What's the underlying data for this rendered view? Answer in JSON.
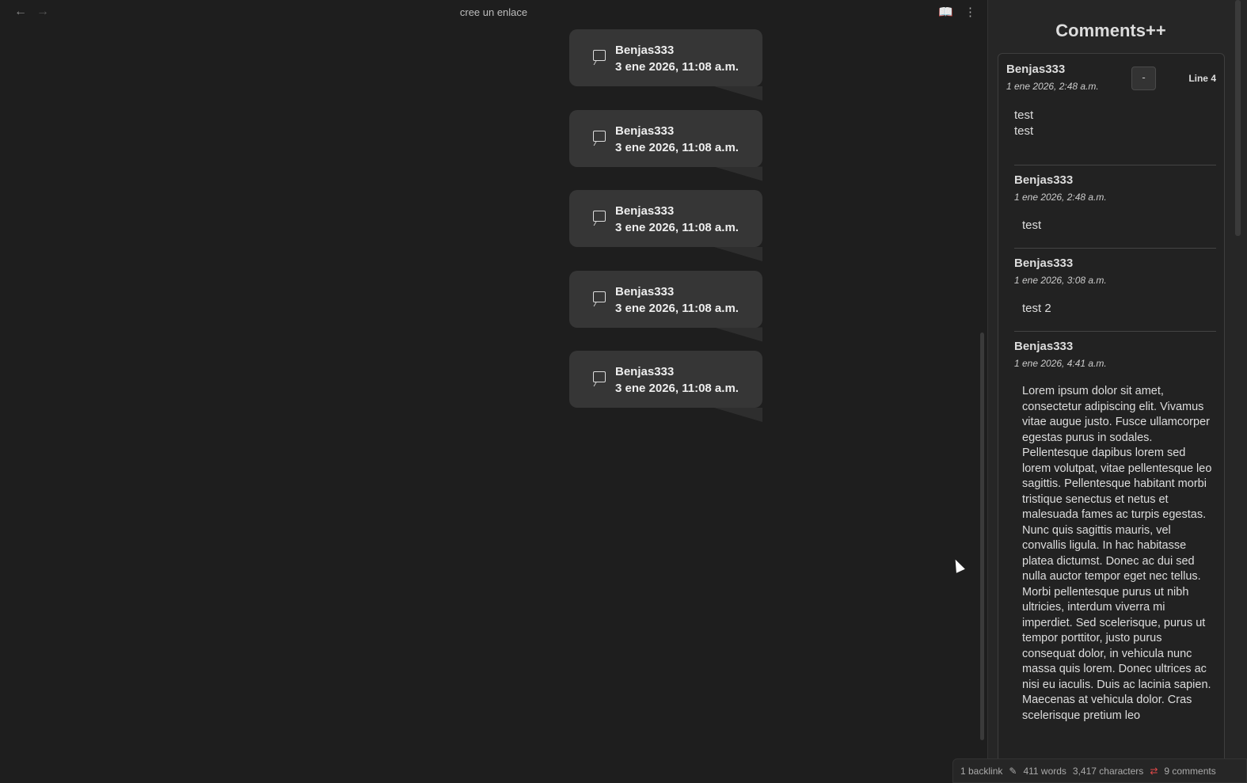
{
  "header": {
    "title": "cree un enlace"
  },
  "cards": [
    {
      "author": "Benjas333",
      "date": "3 ene 2026, 11:08 a.m."
    },
    {
      "author": "Benjas333",
      "date": "3 ene 2026, 11:08 a.m."
    },
    {
      "author": "Benjas333",
      "date": "3 ene 2026, 11:08 a.m."
    },
    {
      "author": "Benjas333",
      "date": "3 ene 2026, 11:08 a.m."
    },
    {
      "author": "Benjas333",
      "date": "3 ene 2026, 11:08 a.m."
    }
  ],
  "sidebar": {
    "title": "Comments++",
    "thread": {
      "author": "Benjas333",
      "date": "1 ene 2026, 2:48 a.m.",
      "collapse_label": "-",
      "line": "Line 4",
      "body_lines": [
        "test",
        "test"
      ]
    },
    "replies": [
      {
        "author": "Benjas333",
        "date": "1 ene 2026, 2:48 a.m.",
        "body": "test"
      },
      {
        "author": "Benjas333",
        "date": "1 ene 2026, 3:08 a.m.",
        "body": "test 2"
      },
      {
        "author": "Benjas333",
        "date": "1 ene 2026, 4:41 a.m.",
        "body": "Lorem ipsum dolor sit amet, consectetur adipiscing elit. Vivamus vitae augue justo. Fusce ullamcorper egestas purus in sodales. Pellentesque dapibus lorem sed lorem volutpat, vitae pellentesque leo sagittis. Pellentesque habitant morbi tristique senectus et netus et malesuada fames ac turpis egestas. Nunc quis sagittis mauris, vel convallis ligula. In hac habitasse platea dictumst. Donec ac dui sed nulla auctor tempor eget nec tellus. Morbi pellentesque purus ut nibh ultricies, interdum viverra mi imperdiet. Sed scelerisque, purus ut tempor porttitor, justo purus consequat dolor, in vehicula nunc massa quis lorem. Donec ultrices ac nisi eu iaculis. Duis ac lacinia sapien. Maecenas at vehicula dolor. Cras scelerisque pretium leo"
      }
    ]
  },
  "status": {
    "backlinks": "1 backlink",
    "words": "411 words",
    "characters": "3,417 characters",
    "comments": "9 comments"
  },
  "colors": {
    "accent_red": "#e04848"
  }
}
